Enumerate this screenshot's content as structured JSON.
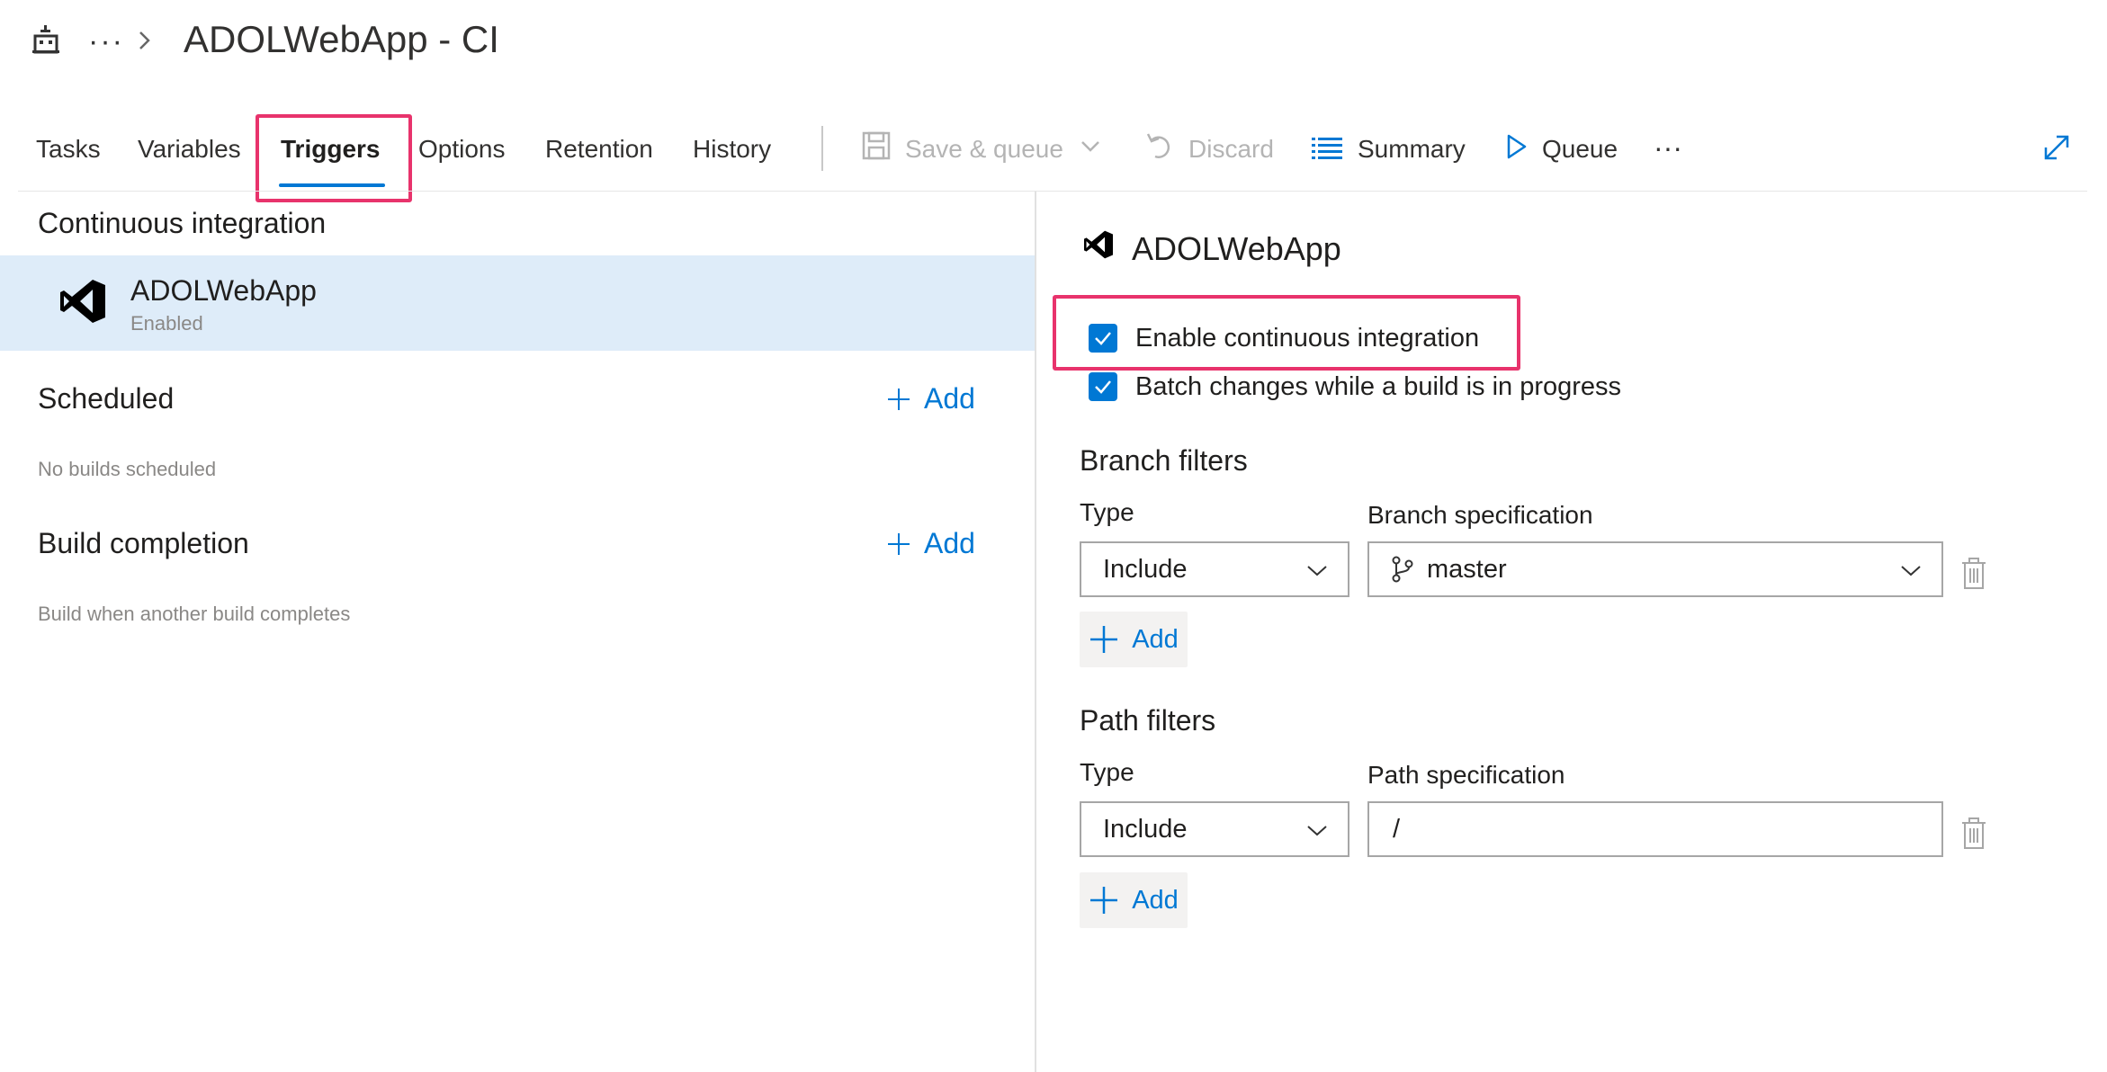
{
  "header": {
    "overflow_label": "···",
    "title": "ADOLWebApp - CI"
  },
  "tabs": [
    {
      "label": "Tasks"
    },
    {
      "label": "Variables"
    },
    {
      "label": "Triggers",
      "active": true
    },
    {
      "label": "Options"
    },
    {
      "label": "Retention"
    },
    {
      "label": "History"
    }
  ],
  "toolbar": {
    "save_queue_label": "Save & queue",
    "discard_label": "Discard",
    "summary_label": "Summary",
    "queue_label": "Queue",
    "more_label": "···"
  },
  "left": {
    "ci_heading": "Continuous integration",
    "ci_item": {
      "name": "ADOLWebApp",
      "status": "Enabled"
    },
    "scheduled_heading": "Scheduled",
    "scheduled_add": "Add",
    "scheduled_empty": "No builds scheduled",
    "completion_heading": "Build completion",
    "completion_add": "Add",
    "completion_desc": "Build when another build completes"
  },
  "right": {
    "title": "ADOLWebApp",
    "enable_ci_label": "Enable continuous integration",
    "enable_ci_checked": true,
    "batch_label": "Batch changes while a build is in progress",
    "batch_checked": true,
    "branch_filters": {
      "heading": "Branch filters",
      "type_label": "Type",
      "spec_label": "Branch specification",
      "type_value": "Include",
      "spec_value": "master",
      "add_label": "Add"
    },
    "path_filters": {
      "heading": "Path filters",
      "type_label": "Type",
      "spec_label": "Path specification",
      "type_value": "Include",
      "spec_value": "/",
      "add_label": "Add"
    }
  },
  "colors": {
    "accent": "#0078d4",
    "highlight": "#e8336c",
    "selected_row": "#deecf9"
  }
}
